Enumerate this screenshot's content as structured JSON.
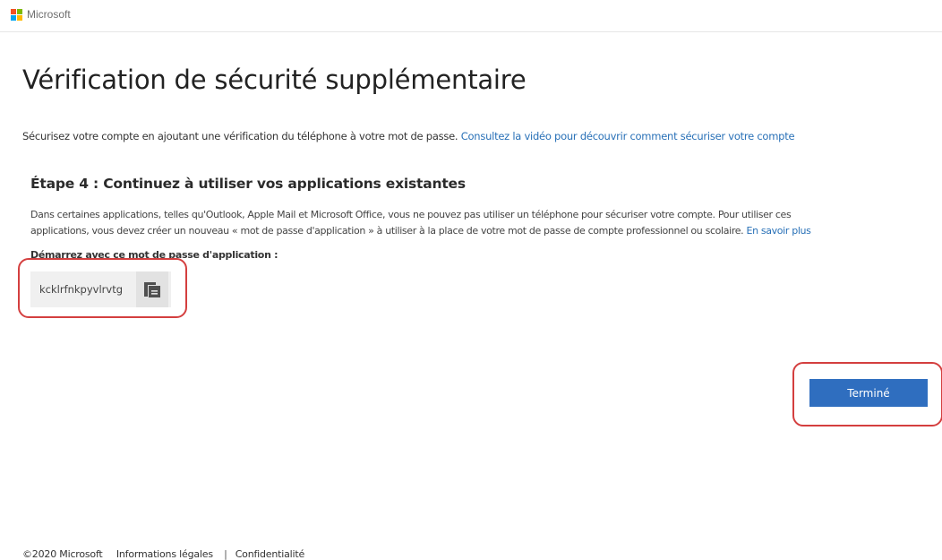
{
  "header": {
    "brand": "Microsoft",
    "logo_colors": [
      "#f25022",
      "#7fba00",
      "#00a4ef",
      "#ffb900"
    ]
  },
  "page": {
    "title": "Vérification de sécurité supplémentaire",
    "intro_text": "Sécurisez votre compte en ajoutant une vérification du téléphone à votre mot de passe.",
    "intro_link": "Consultez la vidéo pour découvrir comment sécuriser votre compte"
  },
  "step": {
    "title": "Étape 4 : Continuez à utiliser vos applications existantes",
    "desc_line1": "Dans certaines applications, telles qu'Outlook, Apple Mail et Microsoft Office, vous ne pouvez pas utiliser un téléphone pour sécuriser votre compte. Pour utiliser ces",
    "desc_line2": "applications, vous devez créer un nouveau « mot de passe d'application » à utiliser à la place de votre mot de passe de compte professionnel ou scolaire.",
    "learn_more": "En savoir plus",
    "password_label": "Démarrez avec ce mot de passe d'application :",
    "app_password": "kcklrfnkpyvlrvtg",
    "copy_icon": "copy-icon"
  },
  "actions": {
    "done_label": "Terminé",
    "accent_color": "#2f6ebf"
  },
  "annotation_color": "#d43f3f",
  "footer": {
    "copyright": "©2020 Microsoft",
    "legal": "Informations légales",
    "separator": "|",
    "privacy": "Confidentialité"
  }
}
